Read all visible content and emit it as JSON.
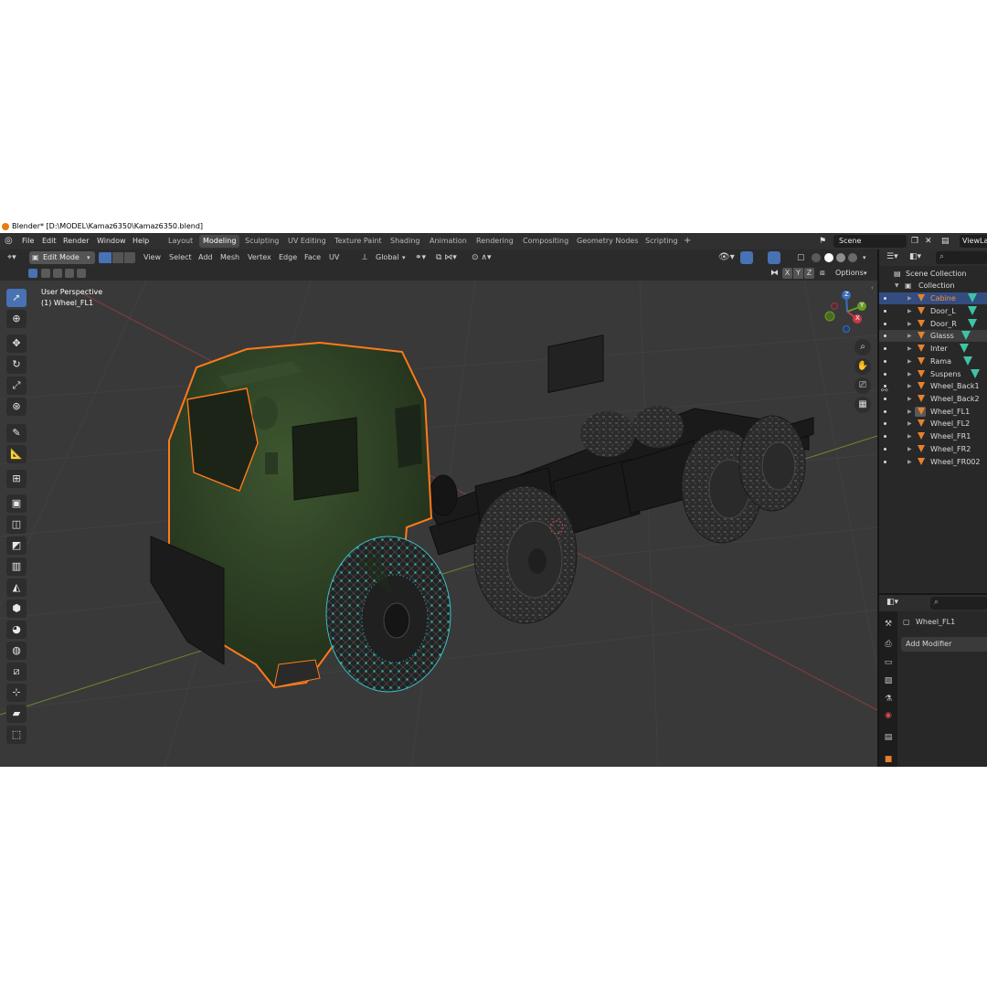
{
  "window": {
    "title": "Blender* [D:\\MODEL\\Kamaz6350\\Kamaz6350.blend]"
  },
  "menu": [
    "File",
    "Edit",
    "Render",
    "Window",
    "Help"
  ],
  "workspaces": [
    {
      "label": "Layout",
      "active": false
    },
    {
      "label": "Modeling",
      "active": true
    },
    {
      "label": "Sculpting",
      "active": false
    },
    {
      "label": "UV Editing",
      "active": false
    },
    {
      "label": "Texture Paint",
      "active": false
    },
    {
      "label": "Shading",
      "active": false
    },
    {
      "label": "Animation",
      "active": false
    },
    {
      "label": "Rendering",
      "active": false
    },
    {
      "label": "Compositing",
      "active": false
    },
    {
      "label": "Geometry Nodes",
      "active": false
    },
    {
      "label": "Scripting",
      "active": false
    }
  ],
  "add_workspace": "+",
  "scene": {
    "name": "Scene",
    "view_layer": "ViewLay"
  },
  "viewport_header": {
    "mode": "Edit Mode",
    "menus": [
      "View",
      "Select",
      "Add",
      "Mesh",
      "Vertex",
      "Edge",
      "Face",
      "UV"
    ],
    "orientation": "Global",
    "axis_x": "X",
    "axis_y": "Y",
    "axis_z": "Z",
    "options": "Options"
  },
  "viewport": {
    "perspective": "User Perspective",
    "object": "(1) Wheel_FL1",
    "gizmo": {
      "x": "X",
      "y": "Y",
      "z": "Z"
    }
  },
  "outliner": {
    "scene_collection": "Scene Collection",
    "collection": "Collection",
    "items": [
      {
        "name": "Cabine",
        "state": "selected"
      },
      {
        "name": "Door_L",
        "state": ""
      },
      {
        "name": "Door_R",
        "state": ""
      },
      {
        "name": "Glasss",
        "state": "highlight"
      },
      {
        "name": "Inter",
        "state": ""
      },
      {
        "name": "Rama",
        "state": ""
      },
      {
        "name": "Suspens",
        "state": ""
      },
      {
        "name": "Wheel_Back1",
        "state": ""
      },
      {
        "name": "Wheel_Back2",
        "state": ""
      },
      {
        "name": "Wheel_FL1",
        "state": "active"
      },
      {
        "name": "Wheel_FL2",
        "state": ""
      },
      {
        "name": "Wheel_FR1",
        "state": ""
      },
      {
        "name": "Wheel_FR2",
        "state": ""
      },
      {
        "name": "Wheel_FR002",
        "state": ""
      }
    ]
  },
  "properties": {
    "object_name": "Wheel_FL1",
    "add_modifier": "Add Modifier"
  },
  "colors": {
    "selection_outline": "#ff7a1a",
    "active_tab": "#4772b3",
    "outliner_selected": "#334d80",
    "vertex_groups": "#3ec3a6",
    "mesh_icon": "#e6822d",
    "truck_body": "#2e4225"
  }
}
